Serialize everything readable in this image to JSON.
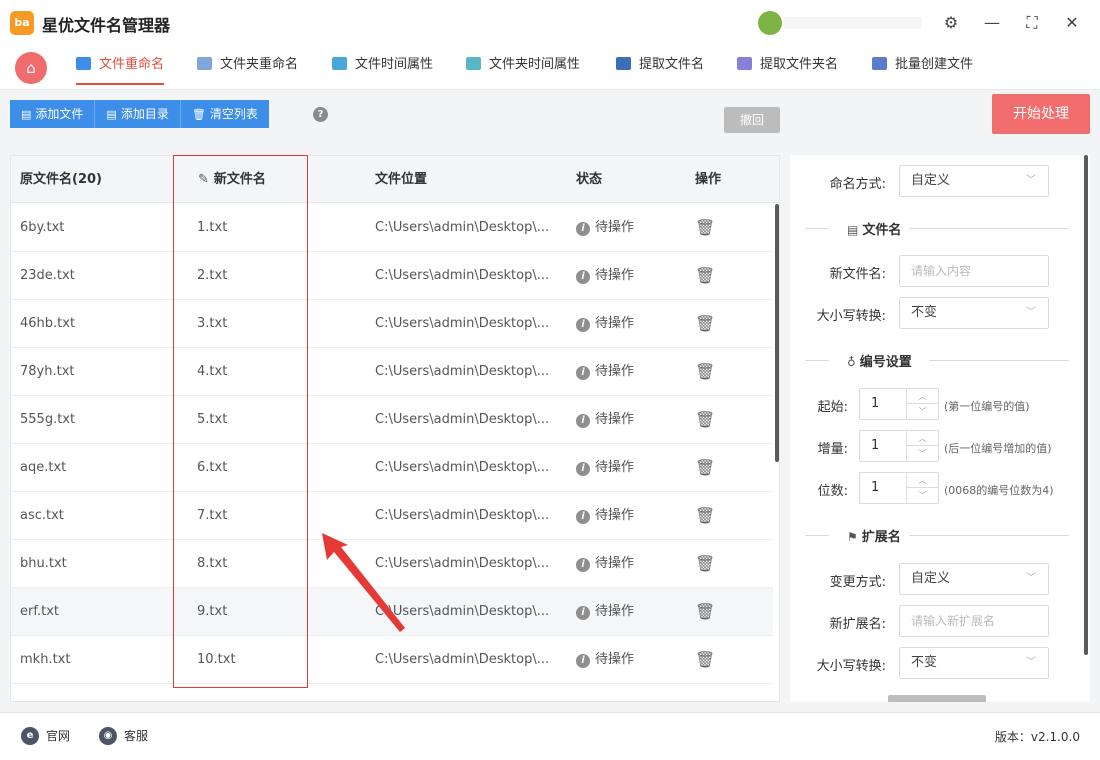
{
  "app": {
    "title": "星优文件名管理器",
    "logo_text": "ba"
  },
  "window_controls": {
    "settings": "⚙",
    "minimize": "—",
    "maximize": "⛶",
    "close": "✕"
  },
  "tabs": [
    {
      "label": "文件重命名",
      "color": "#3d8ee8",
      "active": true
    },
    {
      "label": "文件夹重命名",
      "color": "#7fa7d9",
      "active": false
    },
    {
      "label": "文件时间属性",
      "color": "#4aa8d8",
      "active": false
    },
    {
      "label": "文件夹时间属性",
      "color": "#5bb5c9",
      "active": false
    },
    {
      "label": "提取文件名",
      "color": "#3a6fb5",
      "active": false
    },
    {
      "label": "提取文件夹名",
      "color": "#8a7fd6",
      "active": false
    },
    {
      "label": "批量创建文件",
      "color": "#5b7cc9",
      "active": false
    }
  ],
  "toolbar": {
    "add_file": "添加文件",
    "add_dir": "添加目录",
    "clear_list": "清空列表",
    "help": "?",
    "undo": "撤回",
    "start": "开始处理"
  },
  "table": {
    "headers": {
      "original": "原文件名(20)",
      "new_name": "新文件名",
      "location": "文件位置",
      "status": "状态",
      "action": "操作"
    },
    "rows": [
      {
        "original": "6by.txt",
        "new_name": "1.txt",
        "location": "C:\\Users\\admin\\Desktop\\...",
        "status": "待操作"
      },
      {
        "original": "23de.txt",
        "new_name": "2.txt",
        "location": "C:\\Users\\admin\\Desktop\\...",
        "status": "待操作"
      },
      {
        "original": "46hb.txt",
        "new_name": "3.txt",
        "location": "C:\\Users\\admin\\Desktop\\...",
        "status": "待操作"
      },
      {
        "original": "78yh.txt",
        "new_name": "4.txt",
        "location": "C:\\Users\\admin\\Desktop\\...",
        "status": "待操作"
      },
      {
        "original": "555g.txt",
        "new_name": "5.txt",
        "location": "C:\\Users\\admin\\Desktop\\...",
        "status": "待操作"
      },
      {
        "original": "aqe.txt",
        "new_name": "6.txt",
        "location": "C:\\Users\\admin\\Desktop\\...",
        "status": "待操作"
      },
      {
        "original": "asc.txt",
        "new_name": "7.txt",
        "location": "C:\\Users\\admin\\Desktop\\...",
        "status": "待操作"
      },
      {
        "original": "bhu.txt",
        "new_name": "8.txt",
        "location": "C:\\Users\\admin\\Desktop\\...",
        "status": "待操作"
      },
      {
        "original": "erf.txt",
        "new_name": "9.txt",
        "location": "C:\\Users\\admin\\Desktop\\...",
        "status": "待操作"
      },
      {
        "original": "mkh.txt",
        "new_name": "10.txt",
        "location": "C:\\Users\\admin\\Desktop\\...",
        "status": "待操作"
      }
    ]
  },
  "settings": {
    "naming_method_label": "命名方式:",
    "naming_method_value": "自定义",
    "filename_section": "文件名",
    "new_filename_label": "新文件名:",
    "new_filename_placeholder": "请输入内容",
    "case_label": "大小写转换:",
    "case_value": "不变",
    "numbering_section": "编号设置",
    "start_label": "起始:",
    "start_value": "1",
    "start_hint": "(第一位编号的值)",
    "step_label": "增量:",
    "step_value": "1",
    "step_hint": "(后一位编号增加的值)",
    "digits_label": "位数:",
    "digits_value": "1",
    "digits_hint": "(0068的编号位数为4)",
    "ext_section": "扩展名",
    "change_method_label": "变更方式:",
    "change_method_value": "自定义",
    "new_ext_label": "新扩展名:",
    "new_ext_placeholder": "请输入新扩展名",
    "ext_case_label": "大小写转换:",
    "ext_case_value": "不变"
  },
  "footer": {
    "website": "官网",
    "support": "客服",
    "version": "版本：v2.1.0.0"
  },
  "colors": {
    "accent_blue": "#3d8ee8",
    "accent_red": "#e74c3c",
    "start_button": "#f26d6d",
    "annotation_red": "#e53935"
  }
}
